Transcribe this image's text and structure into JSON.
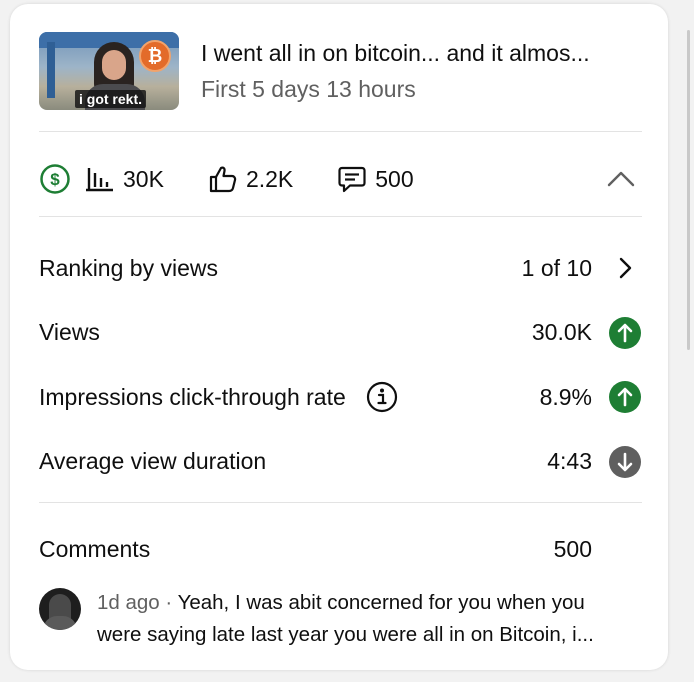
{
  "video": {
    "thumbnail_caption": "i got rekt.",
    "thumbnail_badge": "₿",
    "title": "I went all in on bitcoin... and it almos...",
    "period": "First 5 days 13 hours"
  },
  "stats": {
    "views": "30K",
    "likes": "2.2K",
    "comments": "500"
  },
  "metrics": [
    {
      "label": "Ranking by views",
      "value": "1 of 10",
      "trend": "chevron-right"
    },
    {
      "label": "Views",
      "value": "30.0K",
      "trend": "up"
    },
    {
      "label": "Impressions click-through rate",
      "value": "8.9%",
      "trend": "up"
    },
    {
      "label": "Average view duration",
      "value": "4:43",
      "trend": "down"
    }
  ],
  "comments": {
    "heading": "Comments",
    "count": "500",
    "latest": {
      "age": "1d ago",
      "separator": "·",
      "line1": "Yeah, I was abit concerned for you  when you",
      "line2": "were saying late last year you were all in on Bitcoin, i..."
    }
  },
  "colors": {
    "trend_up": "#1e7e34",
    "trend_down": "#5f5f5f",
    "money": "#1e7e34",
    "text_primary": "#0f0f0f",
    "text_secondary": "#606060"
  }
}
